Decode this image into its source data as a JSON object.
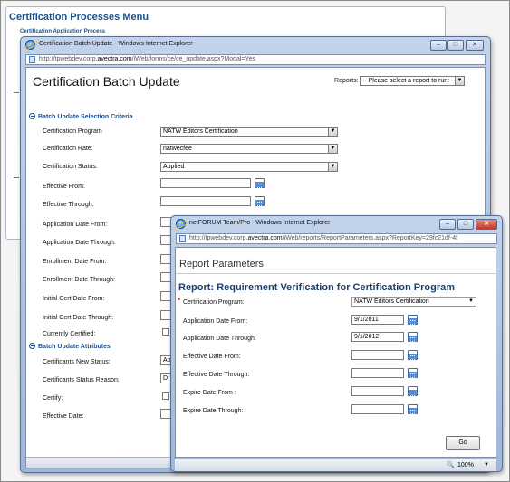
{
  "background_page": {
    "title": "Certification Processes Menu",
    "subtitle": "Certification Application Process"
  },
  "batch_window": {
    "window_title": "Certification Batch Update - Windows Internet Explorer",
    "address": {
      "prefix": "http://tpwebdev.corp.",
      "domain": "avectra.com",
      "suffix": "/iWeb/forms/ce/ce_update.aspx?Modal=Yes"
    },
    "heading": "Certification Batch Update",
    "reports_label": "Reports:",
    "reports_select": "-- Please select a report to run: --",
    "criteria_header": "Batch Update Selection Criteria",
    "criteria": {
      "program_label": "Certification Program",
      "program_value": "NATW Editors Certification",
      "rate_label": "Certification Rate:",
      "rate_value": "natwecfee",
      "status_label": "Certification Status:",
      "status_value": "Applied",
      "eff_from_label": "Effective From:",
      "eff_through_label": "Effective Through:",
      "app_from_label": "Application Date From:",
      "app_through_label": "Application Date Through:",
      "enr_from_label": "Enrollment Date From:",
      "enr_through_label": "Enrollment Date Through:",
      "init_from_label": "Initial Cert Date From:",
      "init_through_label": "Initial Cert Date Through:",
      "currently_label": "Currently Certified:"
    },
    "attributes_header": "Batch Update Attributes",
    "attributes": {
      "new_status_label": "Certificants New Status:",
      "new_status_value": "Ap",
      "status_reason_label": "Certificants Status Reason:",
      "status_reason_value": "D",
      "certify_label": "Certify:",
      "effective_date_label": "Effective Date:"
    }
  },
  "report_window": {
    "window_title": "netFORUM Team/Pro - Windows Internet Explorer",
    "address": {
      "prefix": "http://tpwebdev.corp.",
      "domain": "avectra.com",
      "suffix": "/iWeb/reports/ReportParameters.aspx?ReportKey=29fc21df-4f"
    },
    "header": "Report Parameters",
    "report_title": "Report: Requirement Verification for Certification Program",
    "required_mark": "*",
    "fields": {
      "program_label": "Certification Program:",
      "program_value": "NATW Editors Certification",
      "app_from_label": "Application Date From:",
      "app_from_value": "9/1/2011",
      "app_through_label": "Application Date Through:",
      "app_through_value": "9/1/2012",
      "eff_from_label": "Effective Date From:",
      "eff_through_label": "Effective Date Through:",
      "exp_from_label": "Expire Date From :",
      "exp_through_label": "Expire Date Through:"
    },
    "go_label": "Go",
    "zoom": "100%"
  },
  "icons": [
    "ie-icon",
    "page-icon",
    "calendar-icon",
    "minimize-icon",
    "maximize-icon",
    "close-icon",
    "collapse-section-icon",
    "dropdown-arrow-icon",
    "zoom-icon"
  ]
}
